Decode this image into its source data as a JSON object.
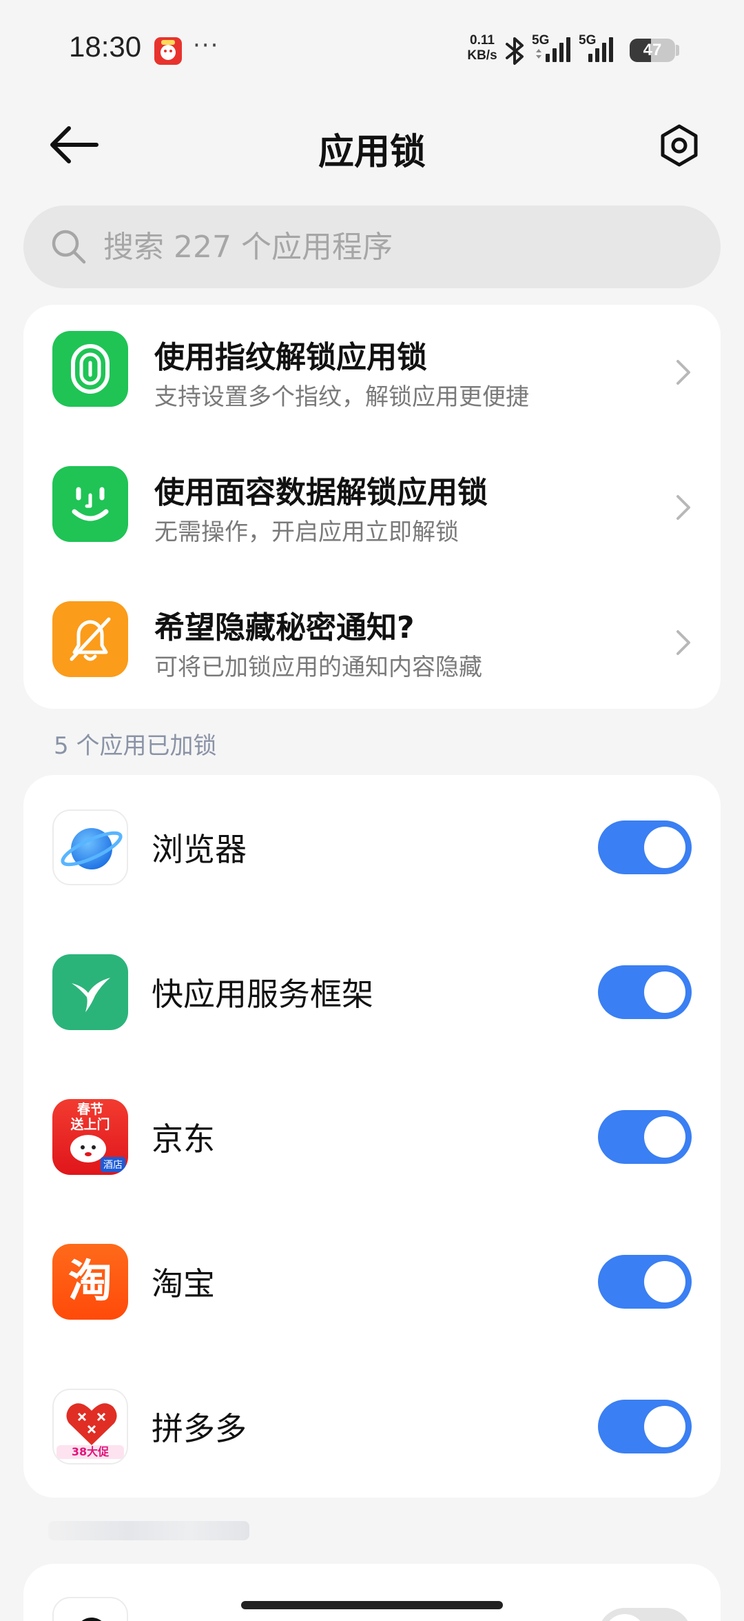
{
  "status_bar": {
    "time": "18:30",
    "more": "···",
    "net_speed_value": "0.11",
    "net_speed_unit": "KB/s",
    "signal1_label": "5G",
    "signal2_label": "5G",
    "battery": "47",
    "battery_level": 0.47
  },
  "header": {
    "title": "应用锁",
    "back_icon": "arrow-left-icon",
    "settings_icon": "settings-hexagon-icon"
  },
  "search": {
    "placeholder": "搜索 227 个应用程序",
    "value": ""
  },
  "features": [
    {
      "title": "使用指纹解锁应用锁",
      "subtitle": "支持设置多个指纹，解锁应用更便捷",
      "icon": "fingerprint-icon",
      "color": "#1fc455"
    },
    {
      "title": "使用面容数据解锁应用锁",
      "subtitle": "无需操作，开启应用立即解锁",
      "icon": "face-icon",
      "color": "#1fc455"
    },
    {
      "title": "希望隐藏秘密通知?",
      "subtitle": "可将已加锁应用的通知内容隐藏",
      "icon": "bell-off-icon",
      "color": "#fb9c1a"
    }
  ],
  "locked_section": {
    "label": "5 个应用已加锁"
  },
  "apps": [
    {
      "name": "浏览器",
      "icon": "browser-planet-icon",
      "enabled": true
    },
    {
      "name": "快应用服务框架",
      "icon": "hummingbird-icon",
      "enabled": true
    },
    {
      "name": "京东",
      "icon": "jd-icon",
      "enabled": true,
      "icon_text_1": "春节",
      "icon_text_2": "送上门",
      "icon_badge": "酒店"
    },
    {
      "name": "淘宝",
      "icon": "taobao-icon",
      "enabled": true,
      "icon_text": "淘"
    },
    {
      "name": "拼多多",
      "icon": "pinduoduo-icon",
      "enabled": true,
      "icon_badge": "38大促"
    }
  ],
  "colors": {
    "accent": "#3a7ff3",
    "background": "#f5f5f5",
    "card": "#ffffff"
  }
}
